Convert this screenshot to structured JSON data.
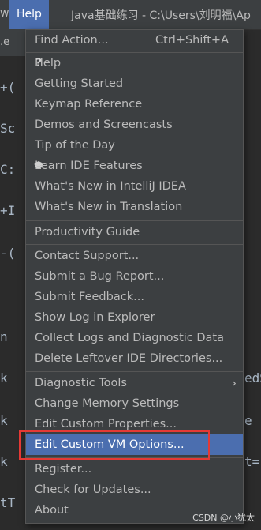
{
  "menubar": {
    "view_fragment": "w",
    "help_label": "Help",
    "window_title": "Java基础练习 - C:\\Users\\刘明福\\Ap"
  },
  "editor_tab": {
    "fragment_a": ".e",
    "fragment_b": "no"
  },
  "editor_fragments": {
    "f1": "+(",
    "f2": "Sc",
    "f3": "C:",
    "f4": "+I",
    "f5": "-(",
    "f6": "n",
    "f7": "k",
    "f8": "edS",
    "f9": "k",
    "f10": "e",
    "f11": "k",
    "f12": "t=",
    "f13": "tT"
  },
  "menu": {
    "find_action": {
      "label": "Find Action...",
      "shortcut": "Ctrl+Shift+A"
    },
    "help": "Help",
    "getting_started": "Getting Started",
    "keymap_reference": "Keymap Reference",
    "demos": "Demos and Screencasts",
    "tip_of_day": "Tip of the Day",
    "learn_ide": "Learn IDE Features",
    "whats_new_idea": "What's New in IntelliJ IDEA",
    "whats_new_translation": "What's New in Translation",
    "productivity_guide": "Productivity Guide",
    "contact_support": "Contact Support...",
    "submit_bug": "Submit a Bug Report...",
    "submit_feedback": "Submit Feedback...",
    "show_log": "Show Log in Explorer",
    "collect_logs": "Collect Logs and Diagnostic Data",
    "delete_leftover": "Delete Leftover IDE Directories...",
    "diagnostic_tools": "Diagnostic Tools",
    "change_memory": "Change Memory Settings",
    "edit_custom_properties": "Edit Custom Properties...",
    "edit_custom_vm": "Edit Custom VM Options...",
    "register": "Register...",
    "check_updates": "Check for Updates...",
    "about": "About"
  },
  "icons": {
    "help": "question-mark-icon",
    "learn": "graduation-cap-icon",
    "submenu": "chevron-right-icon"
  },
  "colors": {
    "selection": "#4b6eaf",
    "annotation_box": "#e53935"
  },
  "watermark": "CSDN @小犹太"
}
